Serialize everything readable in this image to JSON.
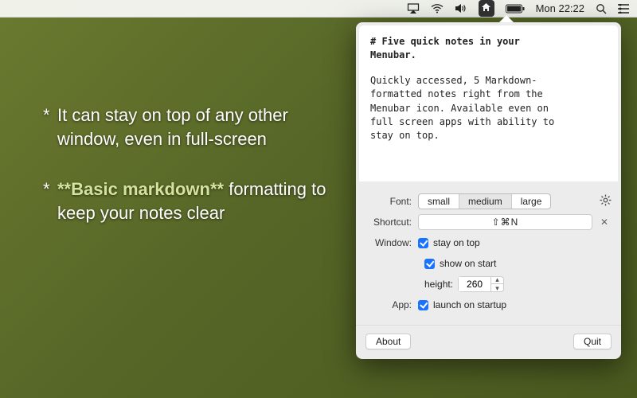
{
  "menubar": {
    "clock": "Mon 22:22"
  },
  "marketing": {
    "bullets": [
      {
        "pre": "It can stay on top of any other window, even in full-screen",
        "bold": "",
        "post": ""
      },
      {
        "pre": "",
        "bold": "**Basic markdown**",
        "post": " formatting to keep your notes clear"
      }
    ]
  },
  "note": {
    "heading1": "# Five quick notes in your",
    "heading2": "Menubar.",
    "body1": "Quickly accessed, 5 Markdown-",
    "body2": "formatted notes right from the",
    "body3": "Menubar icon. Available even on",
    "body4": "full screen apps with ability to",
    "body5": "stay on top."
  },
  "settings": {
    "font_label": "Font:",
    "font_small": "small",
    "font_medium": "medium",
    "font_large": "large",
    "shortcut_label": "Shortcut:",
    "shortcut_value": "⇧⌘N",
    "window_label": "Window:",
    "stay_on_top": "stay on top",
    "show_on_start": "show on start",
    "height_label": "height:",
    "height_value": "260",
    "app_label": "App:",
    "launch_on_startup": "launch on startup",
    "about": "About",
    "quit": "Quit"
  }
}
